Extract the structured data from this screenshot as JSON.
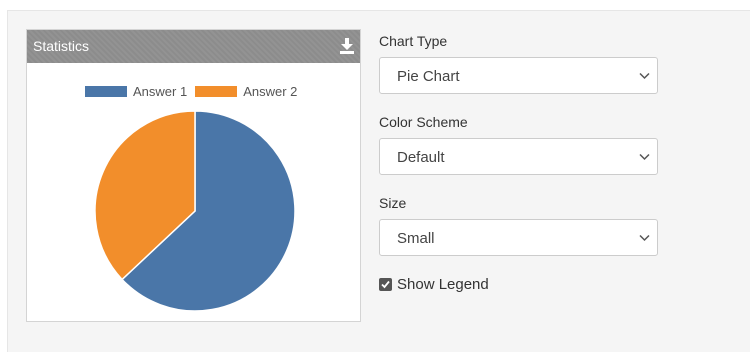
{
  "widget": {
    "title": "Statistics",
    "download_icon": "download-icon"
  },
  "chart_data": {
    "type": "pie",
    "categories": [
      "Answer 1",
      "Answer 2"
    ],
    "values": [
      63,
      37
    ],
    "colors": [
      "#4a76a8",
      "#f28e2b"
    ],
    "legend_position": "top"
  },
  "form": {
    "chart_type": {
      "label": "Chart Type",
      "value": "Pie Chart"
    },
    "color_scheme": {
      "label": "Color Scheme",
      "value": "Default"
    },
    "size": {
      "label": "Size",
      "value": "Small"
    },
    "show_legend": {
      "label": "Show Legend",
      "checked": true
    }
  }
}
